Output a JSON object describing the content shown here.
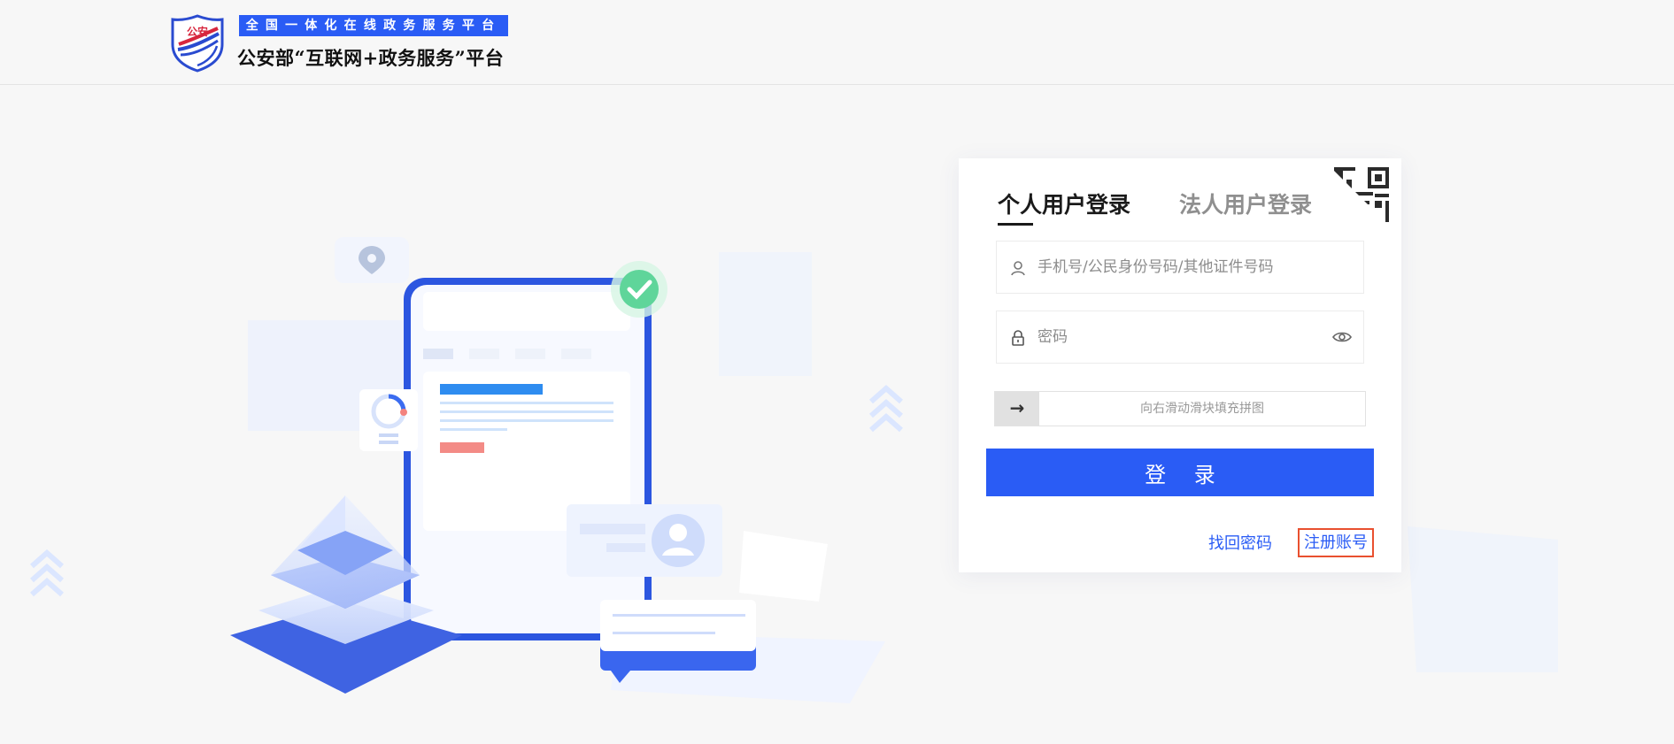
{
  "header": {
    "badge_text": "公安",
    "slogan": "全国一体化在线政务服务平台",
    "platform_name": "公安部“互联网+政务服务”平台"
  },
  "login": {
    "tabs": [
      {
        "label": "个人用户登录",
        "active": true
      },
      {
        "label": "法人用户登录",
        "active": false
      }
    ],
    "account_placeholder": "手机号/公民身份号码/其他证件号码",
    "account_value": "",
    "password_placeholder": "密码",
    "password_value": "",
    "slider_handle": "→",
    "slider_hint": "向右滑动滑块填充拼图",
    "submit_label": "登 录",
    "forgot_label": "找回密码",
    "register_label": "注册账号"
  },
  "colors": {
    "primary": "#2a5cf5",
    "page_bg": "#f7f7f7",
    "highlight_border": "#e9502f"
  },
  "icons": {
    "account": "user-icon",
    "password": "lock-icon",
    "show_password": "eye-icon",
    "qr_login": "qr-code-icon"
  }
}
